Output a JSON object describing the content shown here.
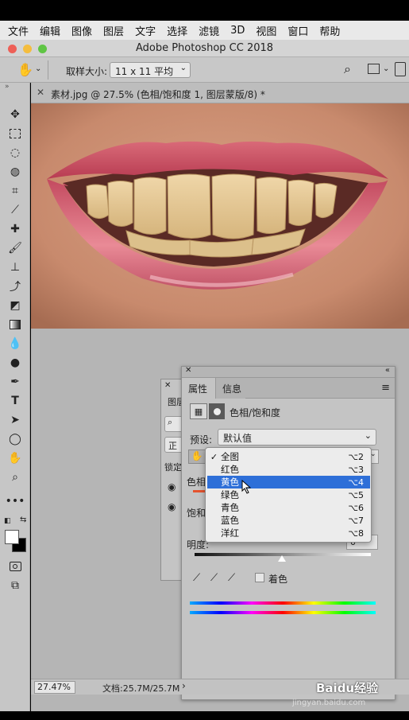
{
  "menu": [
    "文件",
    "编辑",
    "图像",
    "图层",
    "文字",
    "选择",
    "滤镜",
    "3D",
    "视图",
    "窗口",
    "帮助"
  ],
  "window": {
    "title": "Adobe Photoshop CC 2018"
  },
  "options": {
    "sample_label": "取样大小:",
    "sample_value": "11 x 11 平均"
  },
  "document": {
    "tab_title": "素材.jpg @ 27.5% (色相/饱和度 1, 图层蒙版/8) *"
  },
  "back_panel": {
    "tab": "图层",
    "mode_short": "正",
    "lock_short": "锁定"
  },
  "properties": {
    "tab_properties": "属性",
    "tab_info": "信息",
    "adjustment_name": "色相/饱和度",
    "preset_label": "预设:",
    "preset_value": "默认值",
    "hue_label_short": "色相",
    "saturation_label_short": "饱和",
    "lightness_label": "明度:",
    "lightness_value": "0",
    "colorize_label": "着色"
  },
  "dropdown": {
    "items": [
      {
        "label": "全图",
        "shortcut": "⌥2",
        "checked": true,
        "active": false
      },
      {
        "label": "红色",
        "shortcut": "⌥3",
        "checked": false,
        "active": false
      },
      {
        "label": "黄色",
        "shortcut": "⌥4",
        "checked": false,
        "active": true
      },
      {
        "label": "绿色",
        "shortcut": "⌥5",
        "checked": false,
        "active": false
      },
      {
        "label": "青色",
        "shortcut": "⌥6",
        "checked": false,
        "active": false
      },
      {
        "label": "蓝色",
        "shortcut": "⌥7",
        "checked": false,
        "active": false
      },
      {
        "label": "洋红",
        "shortcut": "⌥8",
        "checked": false,
        "active": false
      }
    ]
  },
  "status": {
    "zoom": "27.47%",
    "doc_info": "文档:25.7M/25.7M"
  },
  "watermark": {
    "brand": "Baidu经验",
    "url": "jingyan.baidu.com"
  },
  "colors": {
    "accent": "#2e6fd8",
    "close": "#ee5f57",
    "minimize": "#f4bd3e",
    "zoom": "#5fc544"
  }
}
